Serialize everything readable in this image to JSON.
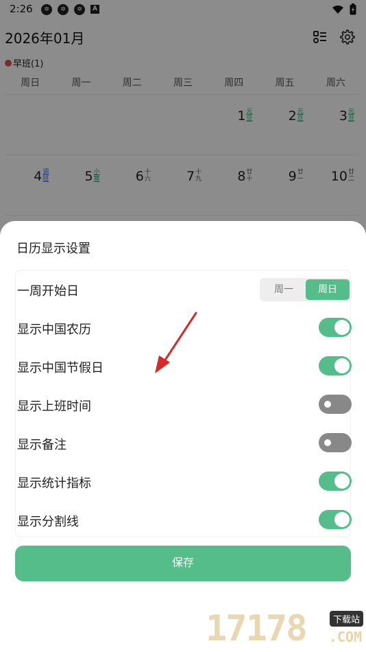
{
  "status_bar": {
    "time": "2:26",
    "app_icons": [
      "app-icon",
      "app-icon",
      "app-icon",
      "text-app-icon"
    ],
    "text_app_glyph": "A"
  },
  "calendar": {
    "month_title": "2026年01月",
    "shift_legend": "早班(1)",
    "weekdays": [
      "周日",
      "周一",
      "周二",
      "周三",
      "周四",
      "周五",
      "周六"
    ],
    "week1": [
      {
        "num": "",
        "lunar": ""
      },
      {
        "num": "",
        "lunar": ""
      },
      {
        "num": "",
        "lunar": ""
      },
      {
        "num": "",
        "lunar": ""
      },
      {
        "num": "1",
        "lunar": "元旦"
      },
      {
        "num": "2",
        "lunar": "元旦"
      },
      {
        "num": "3",
        "lunar": "元旦"
      }
    ],
    "week2": [
      {
        "num": "4",
        "lunar": "调班"
      },
      {
        "num": "5",
        "lunar": "小寒"
      },
      {
        "num": "6",
        "lunar": "十六"
      },
      {
        "num": "7",
        "lunar": "十九"
      },
      {
        "num": "8",
        "lunar": "廿十"
      },
      {
        "num": "9",
        "lunar": "廿一"
      },
      {
        "num": "10",
        "lunar": "廿二"
      }
    ]
  },
  "sheet": {
    "title": "日历显示设置",
    "week_start": {
      "label": "一周开始日",
      "options": [
        "周一",
        "周日"
      ],
      "selected": "周日"
    },
    "toggles": [
      {
        "label": "显示中国农历",
        "on": true
      },
      {
        "label": "显示中国节假日",
        "on": true
      },
      {
        "label": "显示上班时间",
        "on": false
      },
      {
        "label": "显示备注",
        "on": false
      },
      {
        "label": "显示统计指标",
        "on": true
      },
      {
        "label": "显示分割线",
        "on": true
      }
    ],
    "save_label": "保存"
  },
  "colors": {
    "accent": "#55bd8a",
    "toggle_off": "#888888",
    "arrow": "#d42a2a"
  },
  "watermark": {
    "digits": "17178",
    "badge": "下载站",
    "domain": ".COM"
  }
}
